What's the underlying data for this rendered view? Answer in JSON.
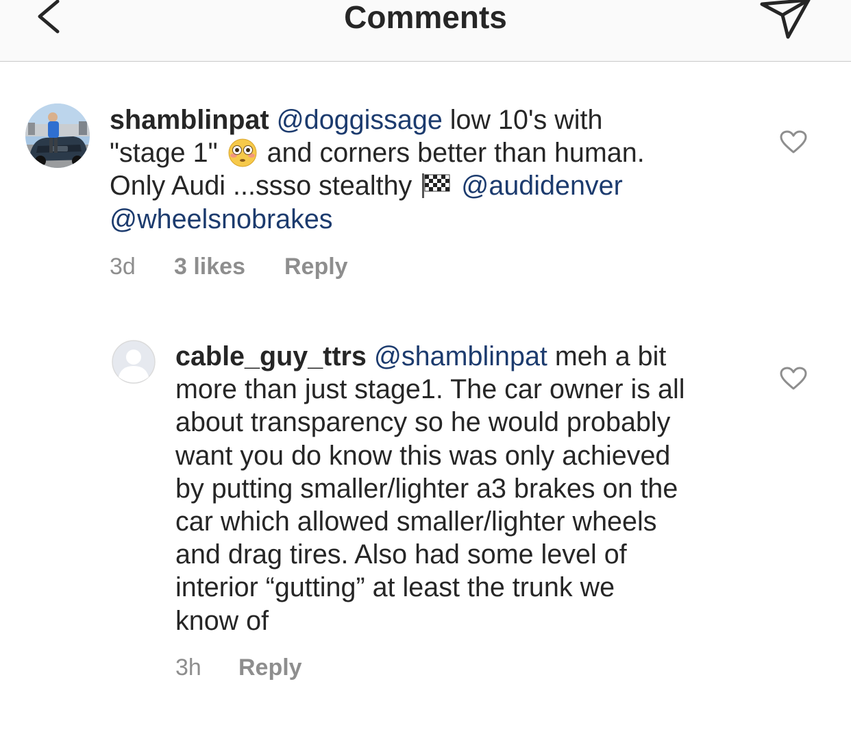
{
  "header": {
    "title": "Comments",
    "back_icon": "chevron-left-icon",
    "send_icon": "paper-plane-icon"
  },
  "comments": [
    {
      "username": "shamblinpat",
      "lines": [
        [
          {
            "t": "mention",
            "v": "@doggissage"
          },
          {
            "t": "text",
            "v": " low 10's with"
          }
        ],
        [
          {
            "t": "text",
            "v": "\"stage 1\" "
          },
          {
            "t": "emoji",
            "v": "flushed-face"
          },
          {
            "t": "text",
            "v": " and corners better than human."
          }
        ],
        [
          {
            "t": "text",
            "v": "Only Audi ...ssso stealthy "
          },
          {
            "t": "emoji",
            "v": "chequered-flag"
          },
          {
            "t": "text",
            "v": " "
          },
          {
            "t": "mention",
            "v": "@audidenver"
          }
        ],
        [
          {
            "t": "mention",
            "v": "@wheelsnobrakes"
          }
        ]
      ],
      "time": "3d",
      "likes": "3 likes",
      "reply": "Reply"
    },
    {
      "username": "cable_guy_ttrs",
      "lines": [
        [
          {
            "t": "mention",
            "v": "@shamblinpat"
          },
          {
            "t": "text",
            "v": " meh a bit"
          }
        ],
        [
          {
            "t": "text",
            "v": "more than just stage1. The car owner is all"
          }
        ],
        [
          {
            "t": "text",
            "v": "about transparency so he would probably"
          }
        ],
        [
          {
            "t": "text",
            "v": "want you do know this was only achieved"
          }
        ],
        [
          {
            "t": "text",
            "v": "by putting smaller/lighter a3 brakes on the"
          }
        ],
        [
          {
            "t": "text",
            "v": "car which allowed smaller/lighter wheels"
          }
        ],
        [
          {
            "t": "text",
            "v": "and drag tires. Also had some level of"
          }
        ],
        [
          {
            "t": "text",
            "v": "interior “gutting” at least the trunk we"
          }
        ],
        [
          {
            "t": "text",
            "v": "know of"
          }
        ]
      ],
      "time": "3h",
      "reply": "Reply"
    }
  ],
  "colors": {
    "mention": "#1c3b6e",
    "meta": "#8e8e8e",
    "text": "#262626",
    "header_bg": "#fafafa"
  }
}
